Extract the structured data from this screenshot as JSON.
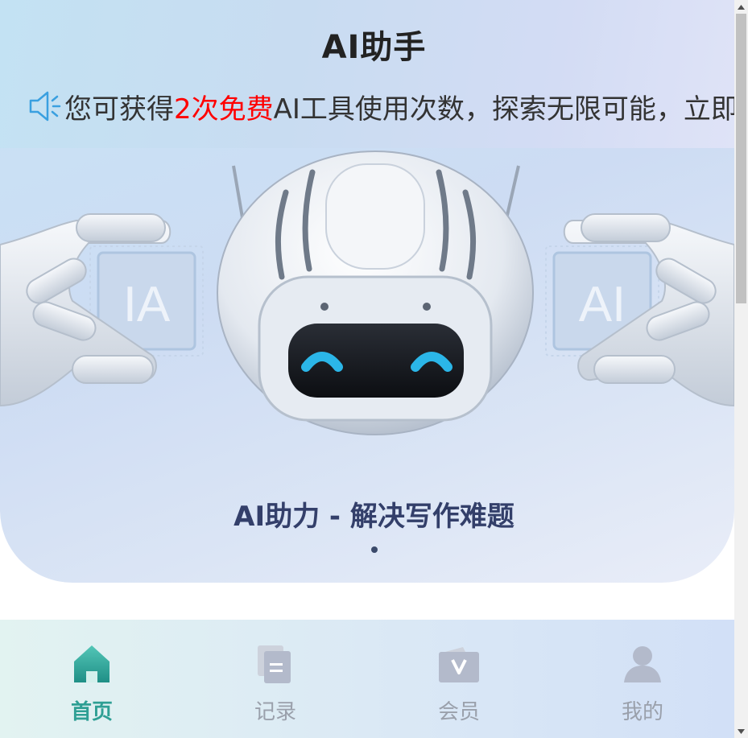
{
  "header": {
    "title": "AI助手"
  },
  "notice": {
    "icon": "speaker-icon",
    "prefix": "您可获得",
    "highlight": "2次免费",
    "suffix": "AI工具使用次数，探索无限可能，立即",
    "highlight_color": "#ff0000"
  },
  "banner": {
    "left_chip_text": "IA",
    "right_chip_text": "AI",
    "caption": "AI助力 - 解决写作难题",
    "carousel_position": 1
  },
  "tabbar": {
    "active_color": "#2e9f94",
    "tabs": [
      {
        "label": "首页",
        "icon": "home-icon",
        "active": true
      },
      {
        "label": "记录",
        "icon": "document-icon",
        "active": false
      },
      {
        "label": "会员",
        "icon": "vip-icon",
        "active": false
      },
      {
        "label": "我的",
        "icon": "user-icon",
        "active": false
      }
    ]
  }
}
